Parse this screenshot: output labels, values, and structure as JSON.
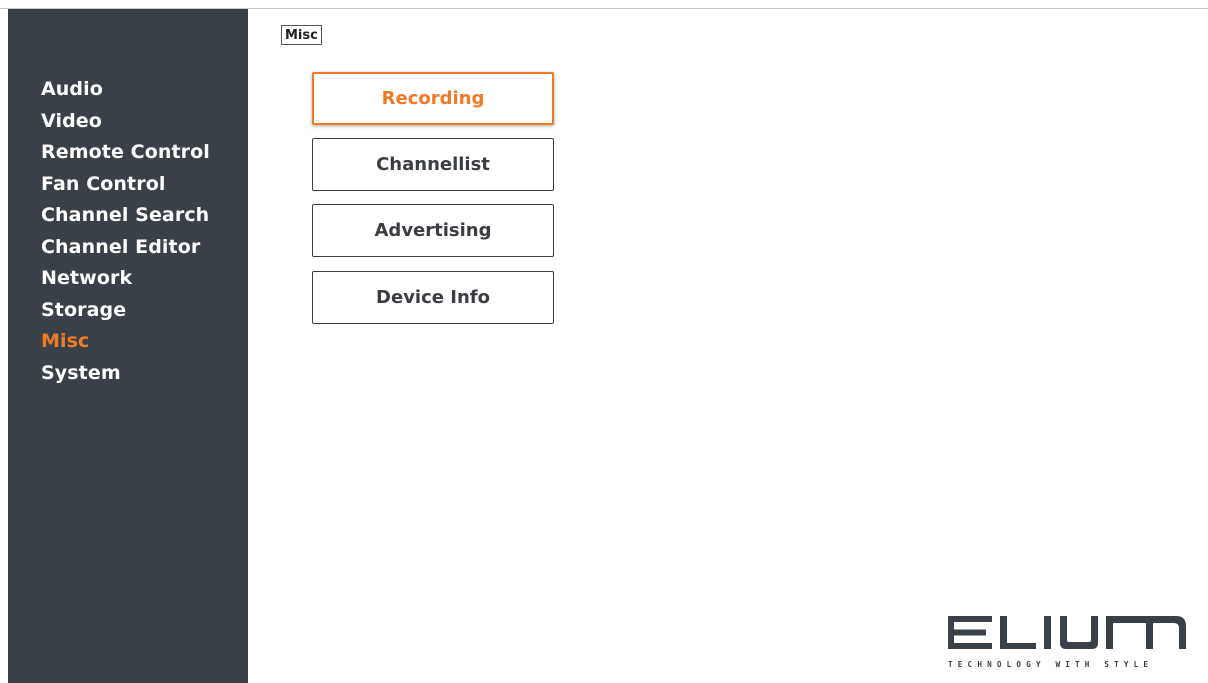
{
  "breadcrumb": "Misc",
  "sidebar": {
    "items": [
      {
        "label": "Audio"
      },
      {
        "label": "Video"
      },
      {
        "label": "Remote Control"
      },
      {
        "label": "Fan Control"
      },
      {
        "label": "Channel Search"
      },
      {
        "label": "Channel Editor"
      },
      {
        "label": "Network"
      },
      {
        "label": "Storage"
      },
      {
        "label": "Misc",
        "active": true
      },
      {
        "label": "System"
      }
    ]
  },
  "menu": {
    "buttons": [
      {
        "label": "Recording",
        "selected": true
      },
      {
        "label": "Channellist"
      },
      {
        "label": "Advertising"
      },
      {
        "label": "Device Info"
      }
    ]
  },
  "logo": {
    "wordmark": "ELIUM",
    "tagline": "TECHNOLOGY WITH STYLE"
  },
  "colors": {
    "accent": "#f07a26",
    "sidebar_bg": "#3a4048",
    "text_dark": "#3a3d42"
  }
}
